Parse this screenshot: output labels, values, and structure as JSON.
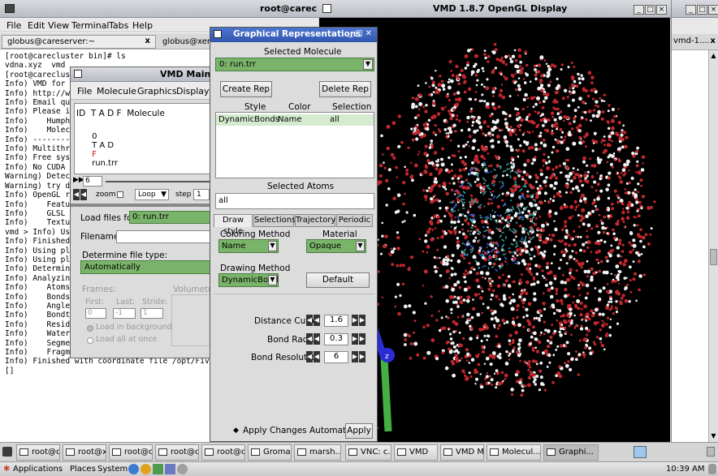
{
  "terminal": {
    "title": "root@carec",
    "menu": [
      "File",
      "Edit",
      "View",
      "Terminal",
      "Tabs",
      "Help"
    ],
    "tabs": [
      "globus@careserver:~",
      "globus@xenclusterl"
    ],
    "tab_close": "x",
    "lines": [
      "[root@carecluster bin]# ls",
      "vdna.xyz  vmd",
      "[root@careclust",
      "Info) VMD for L",
      "Info) http://ww",
      "Info) Email que",
      "Info) Please in",
      "Info)    Humphr",
      "Info)    Molecu",
      "Info) ---------",
      "Info) Multithre",
      "Info) Free syst",
      "Info) No CUDA a",
      "Warning) Detect",
      "Warning) try di",
      "Info) OpenGL re",
      "Info)    Featur",
      "Info)    GLSL re",
      "Info)    Texture",
      "vmd > Info) Usi",
      "Info) Finished ",
      "Info) Using plu",
      "Info) Using plu",
      "Info) Determini",
      "Info) Analyzing",
      "Info)    Atoms:",
      "Info)    Bonds:",
      "Info)    Angles",
      "Info)    Bondty",
      "Info)    Residues: 4499",
      "Info)    Waters: 4334",
      "Info)    Segments: 1",
      "Info)    Fragments: 4335   Protein: 1   Nucleic:",
      "Info) Finished with coordinate file /opt/FiveNode",
      "[]"
    ]
  },
  "vmd_main": {
    "title": "VMD Main",
    "menu": [
      "File",
      "Molecule",
      "Graphics",
      "Display"
    ],
    "columns": "ID  T A D F  Molecule",
    "row": {
      "id": "0",
      "flags": "T A D",
      "f": "F",
      "name": "run.trr"
    },
    "frame_value": "6",
    "zoom_label": "zoom",
    "loop_option": "Loop",
    "step_label": "step",
    "step_value": "1",
    "load_files_label": "Load files for:",
    "load_files_value": "0: run.trr",
    "filename_label": "Filename:",
    "file_type_label": "Determine file type:",
    "file_type_value": "Automatically",
    "frames_label": "Frames:",
    "volumetric_label": "Volumetric",
    "first_label": "First:",
    "last_label": "Last:",
    "stride_label": "Stride:",
    "first_value": "0",
    "last_value": "-1",
    "stride_value": "1",
    "load_background": "Load in background",
    "load_all": "Load all at once"
  },
  "graph_rep": {
    "title": "Graphical Representations",
    "selected_molecule_label": "Selected Molecule",
    "selected_molecule": "0: run.trr",
    "create_rep": "Create Rep",
    "delete_rep": "Delete Rep",
    "headers": [
      "Style",
      "Color",
      "Selection"
    ],
    "rep_row": [
      "DynamicBonds",
      "Name",
      "all"
    ],
    "selected_atoms_label": "Selected Atoms",
    "selected_atoms_value": "all",
    "tabs": [
      "Draw style",
      "Selections",
      "Trajectory",
      "Periodic"
    ],
    "coloring_method_label": "Coloring Method",
    "coloring_method": "Name",
    "material_label": "Material",
    "material": "Opaque",
    "drawing_method_label": "Drawing Method",
    "drawing_method": "DynamicBonds",
    "default_button": "Default",
    "distance_cutoff_label": "Distance Cutoff",
    "distance_cutoff": "1.6",
    "bond_radius_label": "Bond Radius",
    "bond_radius": "0.3",
    "bond_resolution_label": "Bond Resolution",
    "bond_resolution": "6",
    "apply_auto": "Apply Changes Automatically",
    "apply": "Apply"
  },
  "opengl": {
    "title": "VMD 1.8.7 OpenGL Display",
    "axis_label": "z",
    "y_label": "y"
  },
  "right_window": {
    "tab": "vmd-1....",
    "tab_close": "x"
  },
  "taskbar": {
    "items": [
      "root@c...",
      "root@x...",
      "root@c...",
      "root@c...",
      "root@c...",
      "Groma...",
      "marsh...",
      "VNC: c...",
      "VMD",
      "VMD M...",
      "Molecul...",
      "Graphi..."
    ]
  },
  "panel": {
    "menus": [
      "Applications",
      "Places",
      "System"
    ],
    "clock": "10:39 AM"
  },
  "colors": {
    "green": "#7ab46a",
    "oxygen": "#c0282d",
    "hydrogen": "#f2f2f2",
    "protein": "#3a9a9a",
    "window_title_blue": "#2f55b0"
  }
}
